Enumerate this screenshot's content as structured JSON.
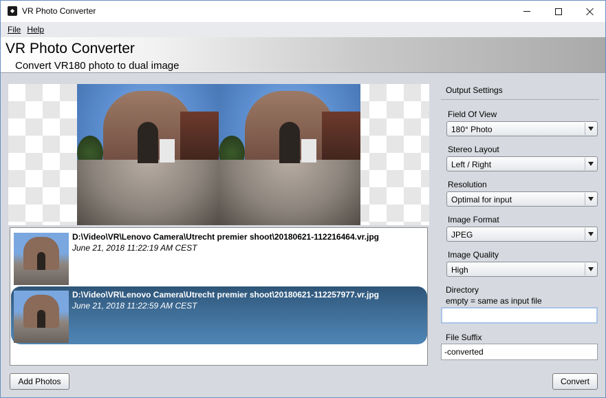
{
  "window": {
    "title": "VR Photo Converter",
    "controls": [
      "minimize",
      "maximize",
      "close"
    ]
  },
  "menu": {
    "items": [
      {
        "label": "File"
      },
      {
        "label": "Help"
      }
    ]
  },
  "banner": {
    "title": "VR Photo Converter",
    "subtitle": "Convert VR180 photo to dual image"
  },
  "preview": {
    "description": "side-by-side fisheye stereo preview"
  },
  "files": [
    {
      "path": "D:\\Video\\VR\\Lenovo Camera\\Utrecht premier shoot\\20180621-112216464.vr.jpg",
      "date": "June 21, 2018 11:22:19 AM CEST",
      "selected": false
    },
    {
      "path": "D:\\Video\\VR\\Lenovo Camera\\Utrecht premier shoot\\20180621-112257977.vr.jpg",
      "date": "June 21, 2018 11:22:59 AM CEST",
      "selected": true
    }
  ],
  "buttons": {
    "add_photos": "Add Photos",
    "convert": "Convert"
  },
  "settings": {
    "title": "Output Settings",
    "field_of_view": {
      "label": "Field Of View",
      "value": "180° Photo"
    },
    "stereo_layout": {
      "label": "Stereo Layout",
      "value": "Left / Right"
    },
    "resolution": {
      "label": "Resolution",
      "value": "Optimal for input"
    },
    "image_format": {
      "label": "Image Format",
      "value": "JPEG"
    },
    "image_quality": {
      "label": "Image Quality",
      "value": "High"
    },
    "directory": {
      "label": "Directory",
      "hint": "empty = same as input file",
      "value": ""
    },
    "file_suffix": {
      "label": "File Suffix",
      "value": "-converted"
    }
  },
  "colors": {
    "selection": "#3d6b94",
    "background": "#d6d9df"
  }
}
